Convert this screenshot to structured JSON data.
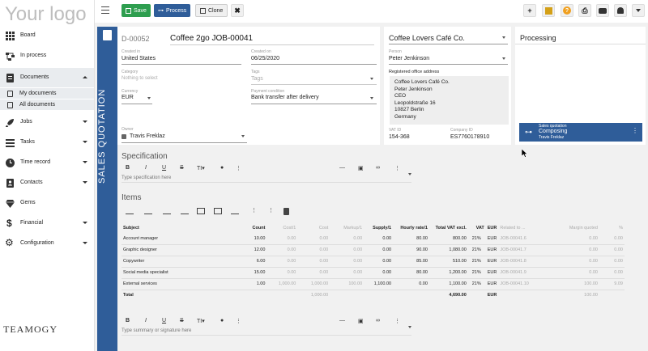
{
  "app": {
    "logo_text": "Your logo",
    "bottom_logo": "TEAMOGY"
  },
  "toolbar": {
    "save_label": "Save",
    "process_label": "Process",
    "clone_label": "Clone",
    "save_color": "#2e9e4f",
    "process_color": "#2f5d99"
  },
  "sidebar": {
    "items": [
      {
        "label": "Board",
        "icon": "grid-icon"
      },
      {
        "label": "In process",
        "icon": "flow-icon"
      },
      {
        "label": "Documents",
        "icon": "document-icon"
      },
      {
        "label": "Jobs",
        "icon": "rocket-icon"
      },
      {
        "label": "Tasks",
        "icon": "tasks-icon"
      },
      {
        "label": "Time record",
        "icon": "clock-icon"
      },
      {
        "label": "Contacts",
        "icon": "contacts-icon"
      },
      {
        "label": "Gems",
        "icon": "gem-icon"
      },
      {
        "label": "Financial",
        "icon": "dollar-icon"
      },
      {
        "label": "Configuration",
        "icon": "gear-icon"
      }
    ],
    "sub_items": [
      {
        "label": "My documents"
      },
      {
        "label": "All documents"
      }
    ]
  },
  "document": {
    "vertical_label": "SALES QUOTATION",
    "number": "D-00052",
    "title": "Coffee 2go JOB-00041",
    "created_in_label": "Created in",
    "created_in": "United States",
    "created_on_label": "Created on",
    "created_on": "06/25/2020",
    "category_label": "Category",
    "category_placeholder": "Nothing to select",
    "tags_label": "Tags",
    "tags_placeholder": "Tags",
    "currency_label": "Currency",
    "currency": "EUR",
    "payment_label": "Payment condition",
    "payment": "Bank transfer after delivery",
    "owner_label": "Owner",
    "owner": "Travis Freklaz"
  },
  "customer": {
    "company": "Coffee Lovers Café Co.",
    "person_label": "Person",
    "person": "Peter Jenkinson",
    "address_label": "Registered office address",
    "address_lines": [
      "Coffee Lovers Café Co.",
      "Peter Jenkinson",
      "CEO",
      "Leopoldstraße 16",
      "10827 Berlin",
      "Germany"
    ],
    "vat_label": "VAT ID",
    "vat": "154-368",
    "company_id_label": "Company ID",
    "company_id": "ES7760178910"
  },
  "processing": {
    "title": "Processing",
    "card_type": "Sales quotation",
    "card_status": "Composing",
    "card_owner": "Travis Freklaz"
  },
  "specification": {
    "title": "Specification",
    "placeholder": "Type specification here"
  },
  "items": {
    "title": "Items",
    "headers": [
      "Subject",
      "Count",
      "Cost/1",
      "Cost",
      "Markup/1",
      "Supply/1",
      "Hourly rate/1",
      "Total VAT excl.",
      "VAT",
      "EUR",
      "Related to ...",
      "Margin quoted",
      "%"
    ],
    "rows": [
      [
        "Account manager",
        "10.00",
        "0.00",
        "0.00",
        "0.00",
        "0.00",
        "80.00",
        "800.00",
        "21%",
        "EUR",
        "JOB-00041.6",
        "0.00",
        "0.00"
      ],
      [
        "Graphic designer",
        "12.00",
        "0.00",
        "0.00",
        "0.00",
        "0.00",
        "90.00",
        "1,080.00",
        "21%",
        "EUR",
        "JOB-00041.7",
        "0.00",
        "0.00"
      ],
      [
        "Copywriter",
        "6.00",
        "0.00",
        "0.00",
        "0.00",
        "0.00",
        "85.00",
        "510.00",
        "21%",
        "EUR",
        "JOB-00041.8",
        "0.00",
        "0.00"
      ],
      [
        "Social media specialist",
        "15.00",
        "0.00",
        "0.00",
        "0.00",
        "0.00",
        "80.00",
        "1,200.00",
        "21%",
        "EUR",
        "JOB-00041.9",
        "0.00",
        "0.00"
      ],
      [
        "External services",
        "1.00",
        "1,000.00",
        "1,000.00",
        "100.00",
        "1,100.00",
        "0.00",
        "1,100.00",
        "21%",
        "EUR",
        "JOB-00041.10",
        "100.00",
        "9.09"
      ]
    ],
    "total": [
      "Total",
      "",
      "",
      "1,000.00",
      "",
      "",
      "",
      "4,690.00",
      "",
      "EUR",
      "",
      "100.00",
      ""
    ]
  },
  "summary": {
    "placeholder": "Type summary or signature here"
  }
}
